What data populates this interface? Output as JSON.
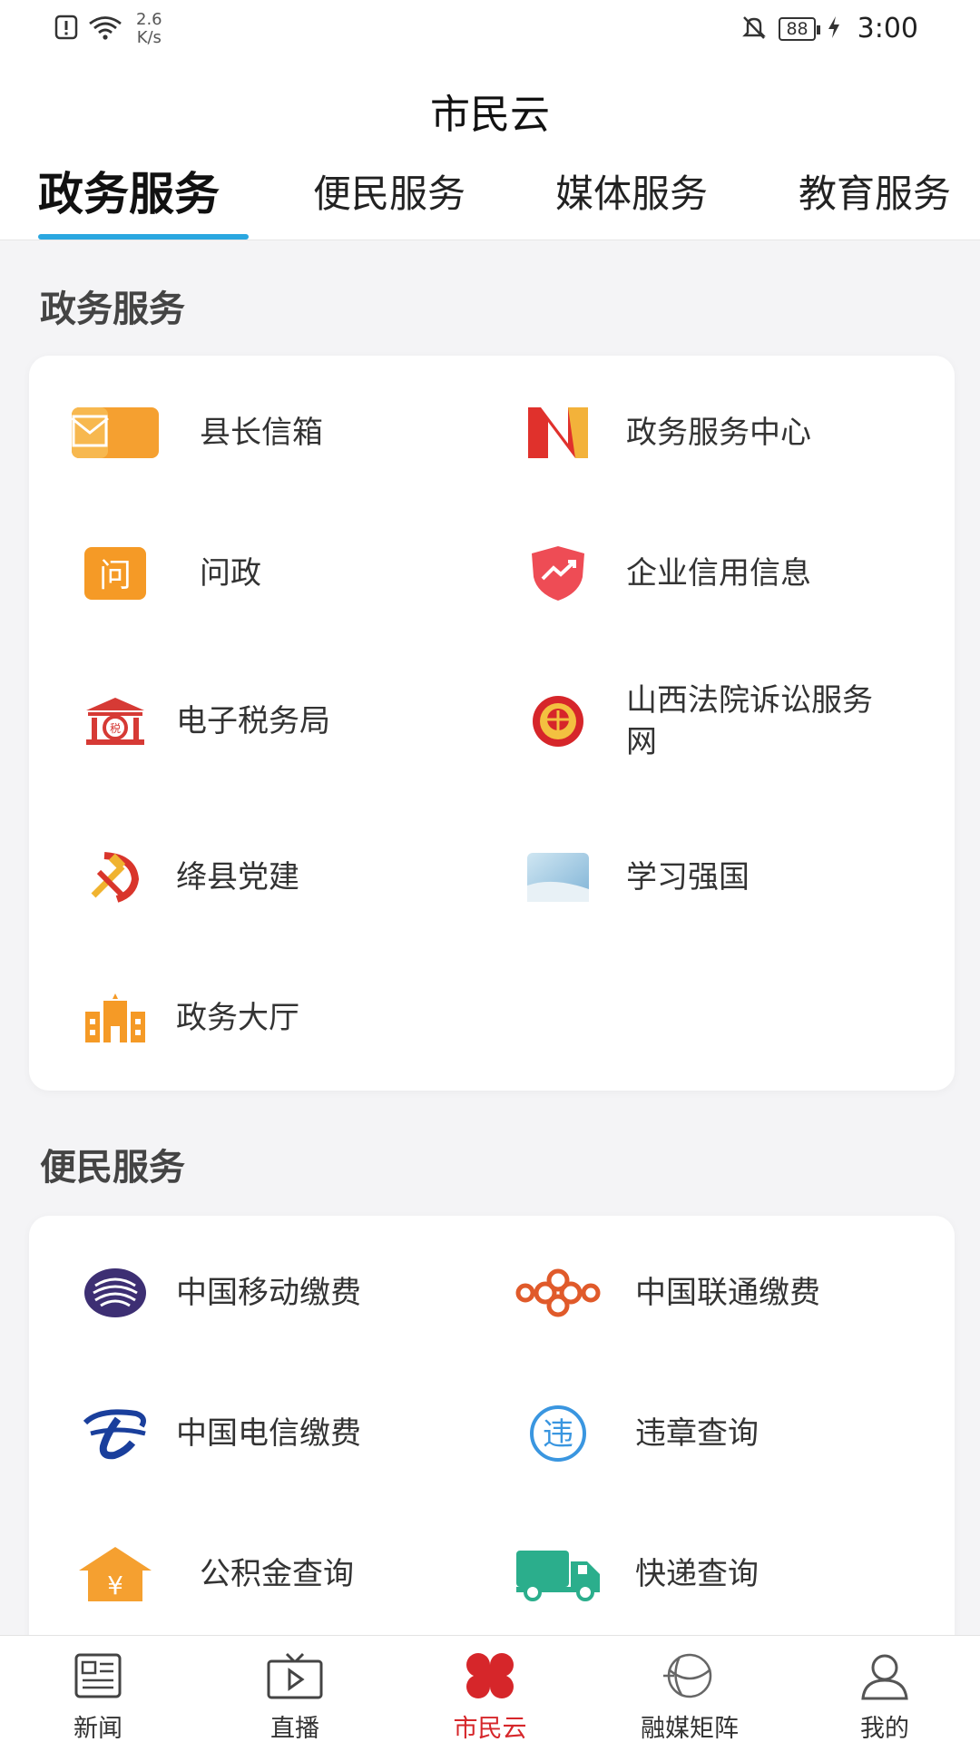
{
  "status_bar": {
    "net_speed_value": "2.6",
    "net_speed_unit": "K/s",
    "battery": "88",
    "time": "3:00"
  },
  "header": {
    "title": "市民云",
    "tabs": [
      {
        "label": "政务服务",
        "active": true
      },
      {
        "label": "便民服务",
        "active": false
      },
      {
        "label": "媒体服务",
        "active": false
      },
      {
        "label": "教育服务",
        "active": false
      }
    ]
  },
  "sections": [
    {
      "title": "政务服务",
      "items": [
        {
          "label": "县长信箱",
          "icon": "mailbox-icon"
        },
        {
          "label": "政务服务中心",
          "icon": "n-logo-icon"
        },
        {
          "label": "问政",
          "icon": "ask-icon"
        },
        {
          "label": "企业信用信息",
          "icon": "shield-trend-icon"
        },
        {
          "label": "电子税务局",
          "icon": "tax-bureau-icon"
        },
        {
          "label": "山西法院诉讼服务网",
          "icon": "court-emblem-icon"
        },
        {
          "label": "绛县党建",
          "icon": "party-emblem-icon"
        },
        {
          "label": "学习强国",
          "icon": "xuexi-icon"
        },
        {
          "label": "政务大厅",
          "icon": "government-hall-icon"
        }
      ]
    },
    {
      "title": "便民服务",
      "items": [
        {
          "label": "中国移动缴费",
          "icon": "china-mobile-icon"
        },
        {
          "label": "中国联通缴费",
          "icon": "china-unicom-icon"
        },
        {
          "label": "中国电信缴费",
          "icon": "china-telecom-icon"
        },
        {
          "label": "违章查询",
          "icon": "violation-icon"
        },
        {
          "label": "公积金查询",
          "icon": "housing-fund-icon"
        },
        {
          "label": "快递查询",
          "icon": "delivery-truck-icon"
        }
      ]
    }
  ],
  "bottom_nav": [
    {
      "label": "新闻",
      "icon": "news-icon",
      "active": false
    },
    {
      "label": "直播",
      "icon": "live-tv-icon",
      "active": false
    },
    {
      "label": "市民云",
      "icon": "clover-icon",
      "active": true
    },
    {
      "label": "融媒矩阵",
      "icon": "media-matrix-icon",
      "active": false
    },
    {
      "label": "我的",
      "icon": "user-icon",
      "active": false
    }
  ],
  "colors": {
    "accent": "#2aa7e0",
    "active_nav": "#d6262a",
    "orange": "#f5a030"
  }
}
